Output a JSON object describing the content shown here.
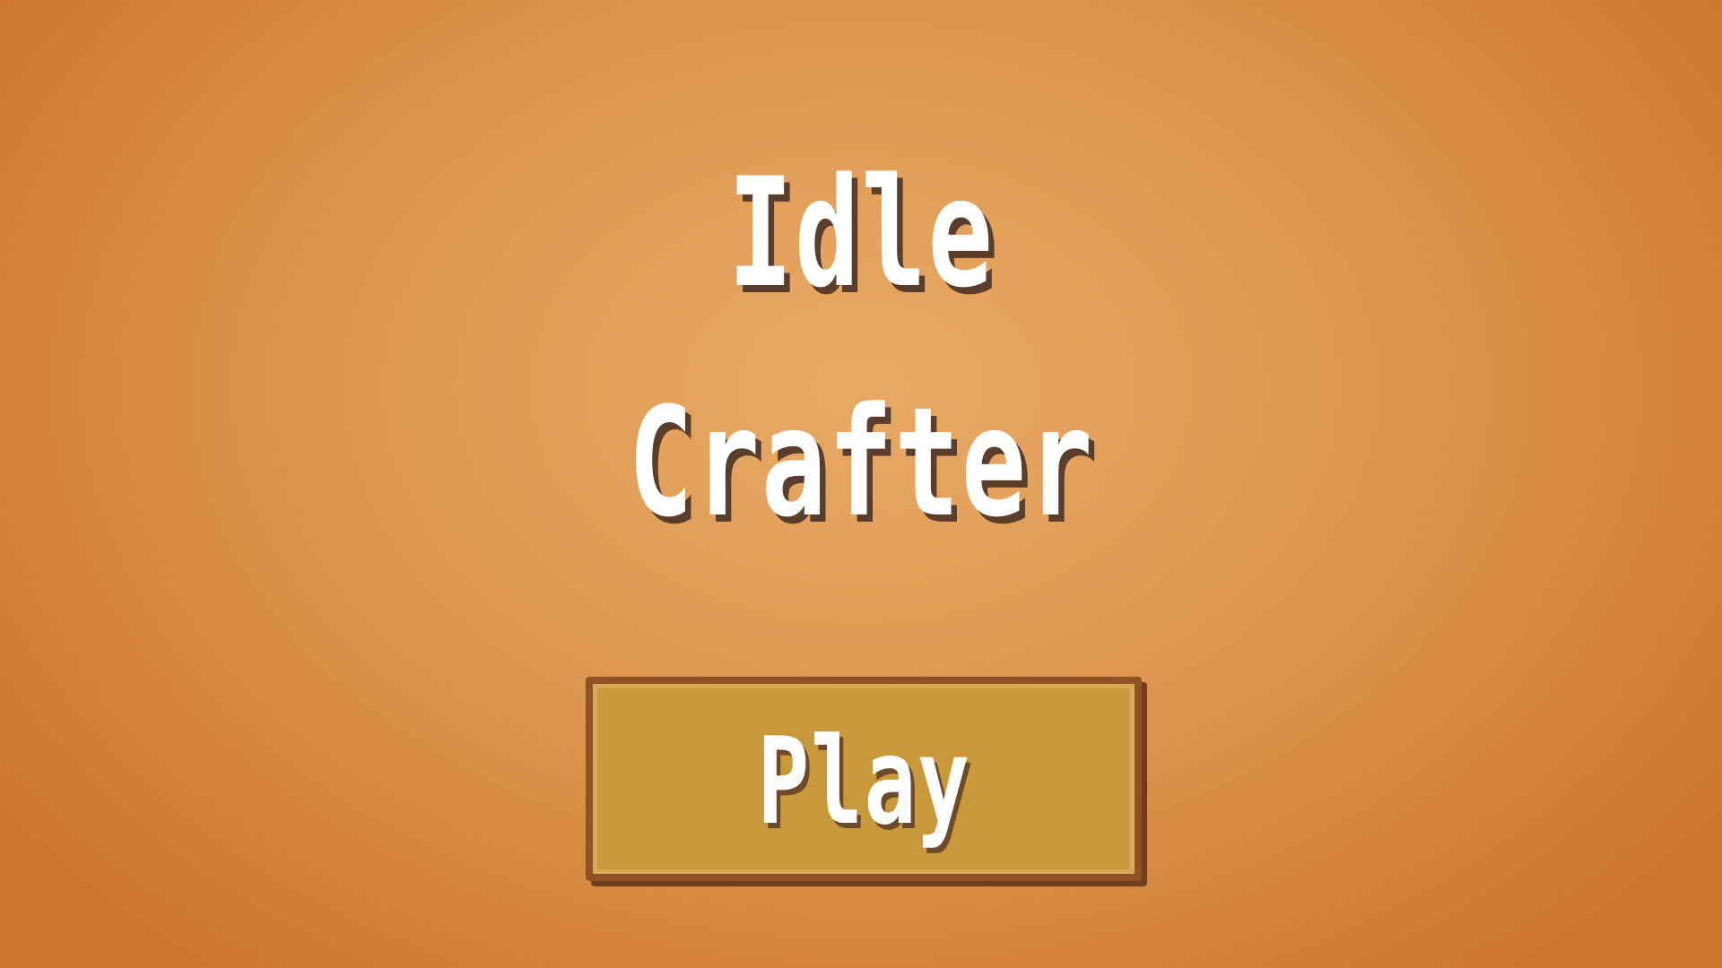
{
  "game": {
    "title_line_1": "Idle",
    "title_line_2": "Crafter"
  },
  "menu": {
    "play_label": "Play"
  },
  "colors": {
    "background_center": "#e8a965",
    "background_edge": "#cc7530",
    "button_fill": "#c8983a",
    "button_border": "#8f5224",
    "text": "#ffffff",
    "text_shadow": "#5a3d2b"
  }
}
